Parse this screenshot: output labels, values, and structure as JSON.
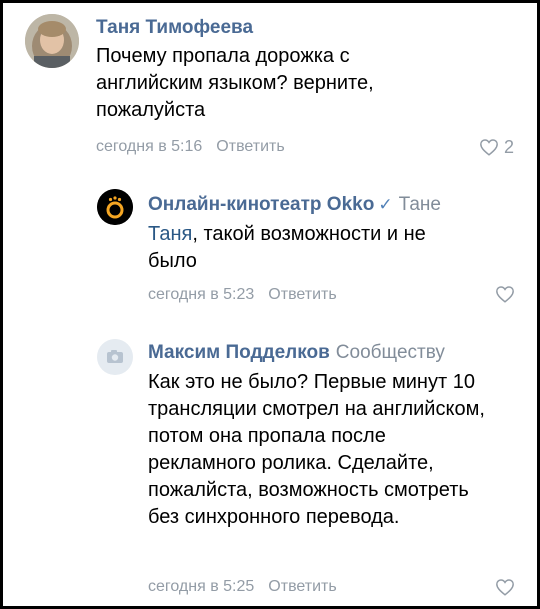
{
  "comments": [
    {
      "author": "Таня Тимофеева",
      "text": "Почему пропала дорожка с английским языком? верните, пожалуйста",
      "time": "сегодня в 5:16",
      "reply_label": "Ответить",
      "likes": "2"
    },
    {
      "author": "Онлайн-кинотеатр Okko",
      "verified": "✓",
      "reply_to": "Тане",
      "mention": "Таня",
      "text": ", такой возможности и не было",
      "time": "сегодня в 5:23",
      "reply_label": "Ответить"
    },
    {
      "author": "Максим Подделков",
      "reply_to": "Сообществу",
      "text": "Как это не было? Первые минут 10 трансляции смотрел на английском, потом она пропала после рекламного ролика. Сделайте, пожалйста, возможность смотреть без синхронного перевода.",
      "time": "сегодня в 5:25",
      "reply_label": "Ответить"
    }
  ],
  "colors": {
    "author": "#4a6a94",
    "meta": "#939ca6",
    "mention": "#2a5885",
    "okko_logo_bg": "#000000",
    "okko_logo_ring": "#f5a623"
  },
  "icons": [
    "heart-outline-icon",
    "camera-placeholder-icon",
    "verified-check-icon",
    "okko-logo"
  ]
}
